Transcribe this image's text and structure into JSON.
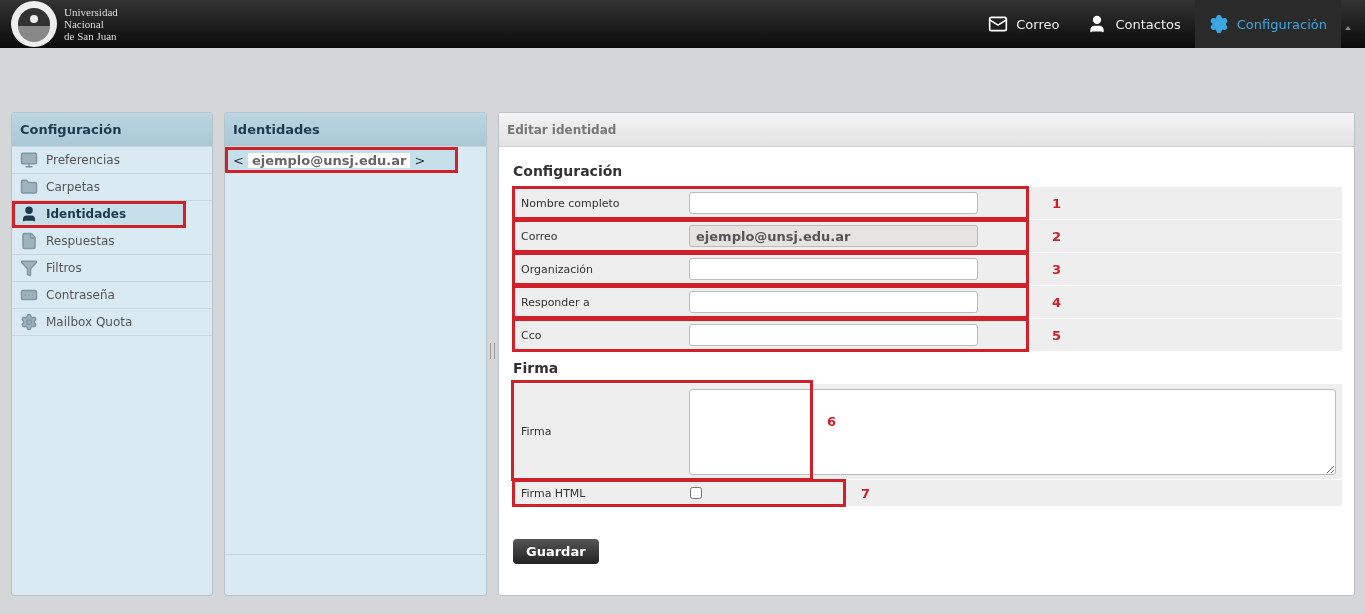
{
  "logo": {
    "lines": [
      "Universidad",
      "Nacional",
      "de San Juan"
    ]
  },
  "nav": [
    {
      "label": "Correo",
      "kind": "mail",
      "selected": false
    },
    {
      "label": "Contactos",
      "kind": "user",
      "selected": false
    },
    {
      "label": "Configuración",
      "kind": "gear",
      "selected": true
    }
  ],
  "sidebar": {
    "title": "Configuración",
    "items": [
      {
        "label": "Preferencias",
        "kind": "monitor",
        "selected": false,
        "highlighted": false
      },
      {
        "label": "Carpetas",
        "kind": "folder",
        "selected": false,
        "highlighted": false
      },
      {
        "label": "Identidades",
        "kind": "user",
        "selected": true,
        "highlighted": true
      },
      {
        "label": "Respuestas",
        "kind": "file",
        "selected": false,
        "highlighted": false
      },
      {
        "label": "Filtros",
        "kind": "filter",
        "selected": false,
        "highlighted": false
      },
      {
        "label": "Contraseña",
        "kind": "password",
        "selected": false,
        "highlighted": false
      },
      {
        "label": "Mailbox Quota",
        "kind": "gear",
        "selected": false,
        "highlighted": false
      }
    ]
  },
  "identities": {
    "title": "Identidades",
    "items": [
      {
        "prefix": "<",
        "email": "ejemplo@unsj.edu.ar",
        "suffix": ">",
        "selected": true,
        "highlighted": true
      }
    ]
  },
  "editor": {
    "title": "Editar identidad",
    "sections": [
      {
        "title": "Configuración",
        "rows": [
          {
            "kind": "text",
            "label": "Nombre completo",
            "annotation": "1",
            "highlighted": true
          },
          {
            "kind": "text",
            "label": "Correo",
            "value": "ejemplo@unsj.edu.ar",
            "disabled": true,
            "annotation": "2",
            "highlighted": true
          },
          {
            "kind": "text",
            "label": "Organización",
            "annotation": "3",
            "highlighted": true
          },
          {
            "kind": "text",
            "label": "Responder a",
            "annotation": "4",
            "highlighted": true
          },
          {
            "kind": "text",
            "label": "Cco",
            "annotation": "5",
            "highlighted": true
          }
        ]
      },
      {
        "title": "Firma",
        "rows": [
          {
            "kind": "textarea",
            "label": "Firma",
            "annotation": "6",
            "highlighted": true
          },
          {
            "kind": "checkbox",
            "label": "Firma HTML",
            "checked": false,
            "annotation": "7",
            "highlighted": true
          }
        ]
      }
    ],
    "save_button": "Guardar"
  }
}
